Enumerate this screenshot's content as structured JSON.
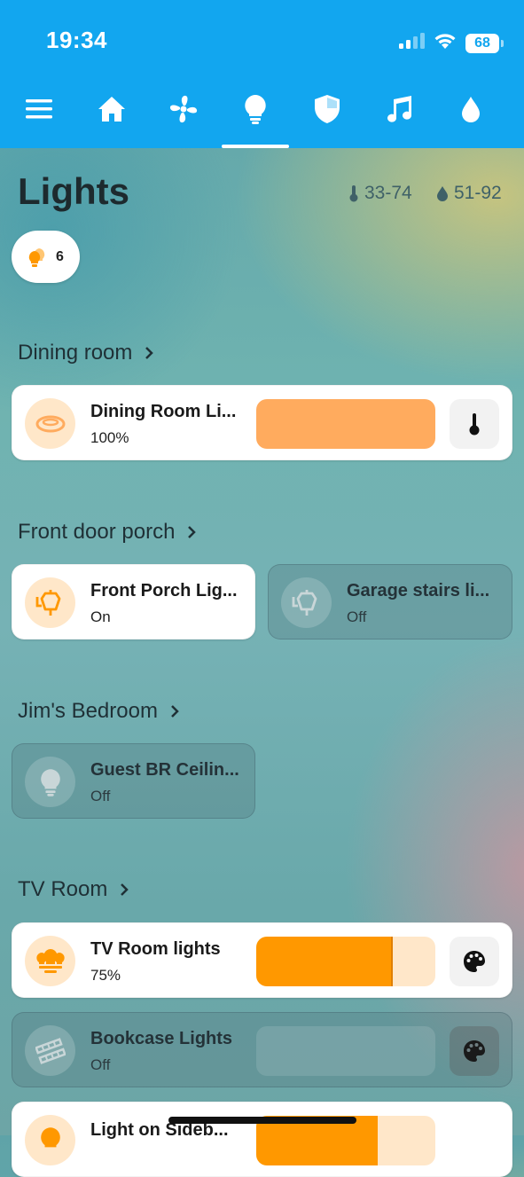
{
  "status": {
    "time": "19:34",
    "battery": "68"
  },
  "nav": {
    "items": [
      {
        "name": "menu",
        "icon": "menu-icon"
      },
      {
        "name": "home",
        "icon": "home-icon"
      },
      {
        "name": "fan",
        "icon": "fan-icon"
      },
      {
        "name": "lights",
        "icon": "lightbulb-icon",
        "active": true
      },
      {
        "name": "security",
        "icon": "shield-icon"
      },
      {
        "name": "music",
        "icon": "music-note-icon"
      },
      {
        "name": "water",
        "icon": "water-drop-icon"
      }
    ]
  },
  "page": {
    "title": "Lights",
    "temp_range": "33-74",
    "humidity_range": "51-92",
    "lights_on_count": "6"
  },
  "sections": {
    "dining": "Dining room",
    "porch": "Front door porch",
    "bedroom": "Jim's Bedroom",
    "tv": "TV Room"
  },
  "cards": {
    "dining_room": {
      "title": "Dining Room Li...",
      "state": "100%",
      "brightness": 100,
      "icon": "ceiling-light-icon"
    },
    "front_porch": {
      "title": "Front Porch Lig...",
      "state": "On",
      "icon": "outdoor-lamp-icon"
    },
    "garage_stairs": {
      "title": "Garage stairs li...",
      "state": "Off",
      "icon": "outdoor-lamp-icon"
    },
    "guest_br": {
      "title": "Guest BR Ceilin...",
      "state": "Off",
      "icon": "lightbulb-icon"
    },
    "tv_room": {
      "title": "TV Room lights",
      "state": "75%",
      "brightness": 75,
      "icon": "lightbulb-group-icon"
    },
    "bookcase": {
      "title": "Bookcase Lights",
      "state": "Off",
      "icon": "led-strip-icon"
    },
    "sideboard": {
      "title": "Light on Sideb...",
      "icon": "lightbulb-icon"
    }
  },
  "colors": {
    "accent": "#12a6ef",
    "light_orange": "#ffab5e",
    "orange": "#ff9800",
    "orange_track": "#ffe7c9",
    "icon_orange": "#ff9800"
  }
}
